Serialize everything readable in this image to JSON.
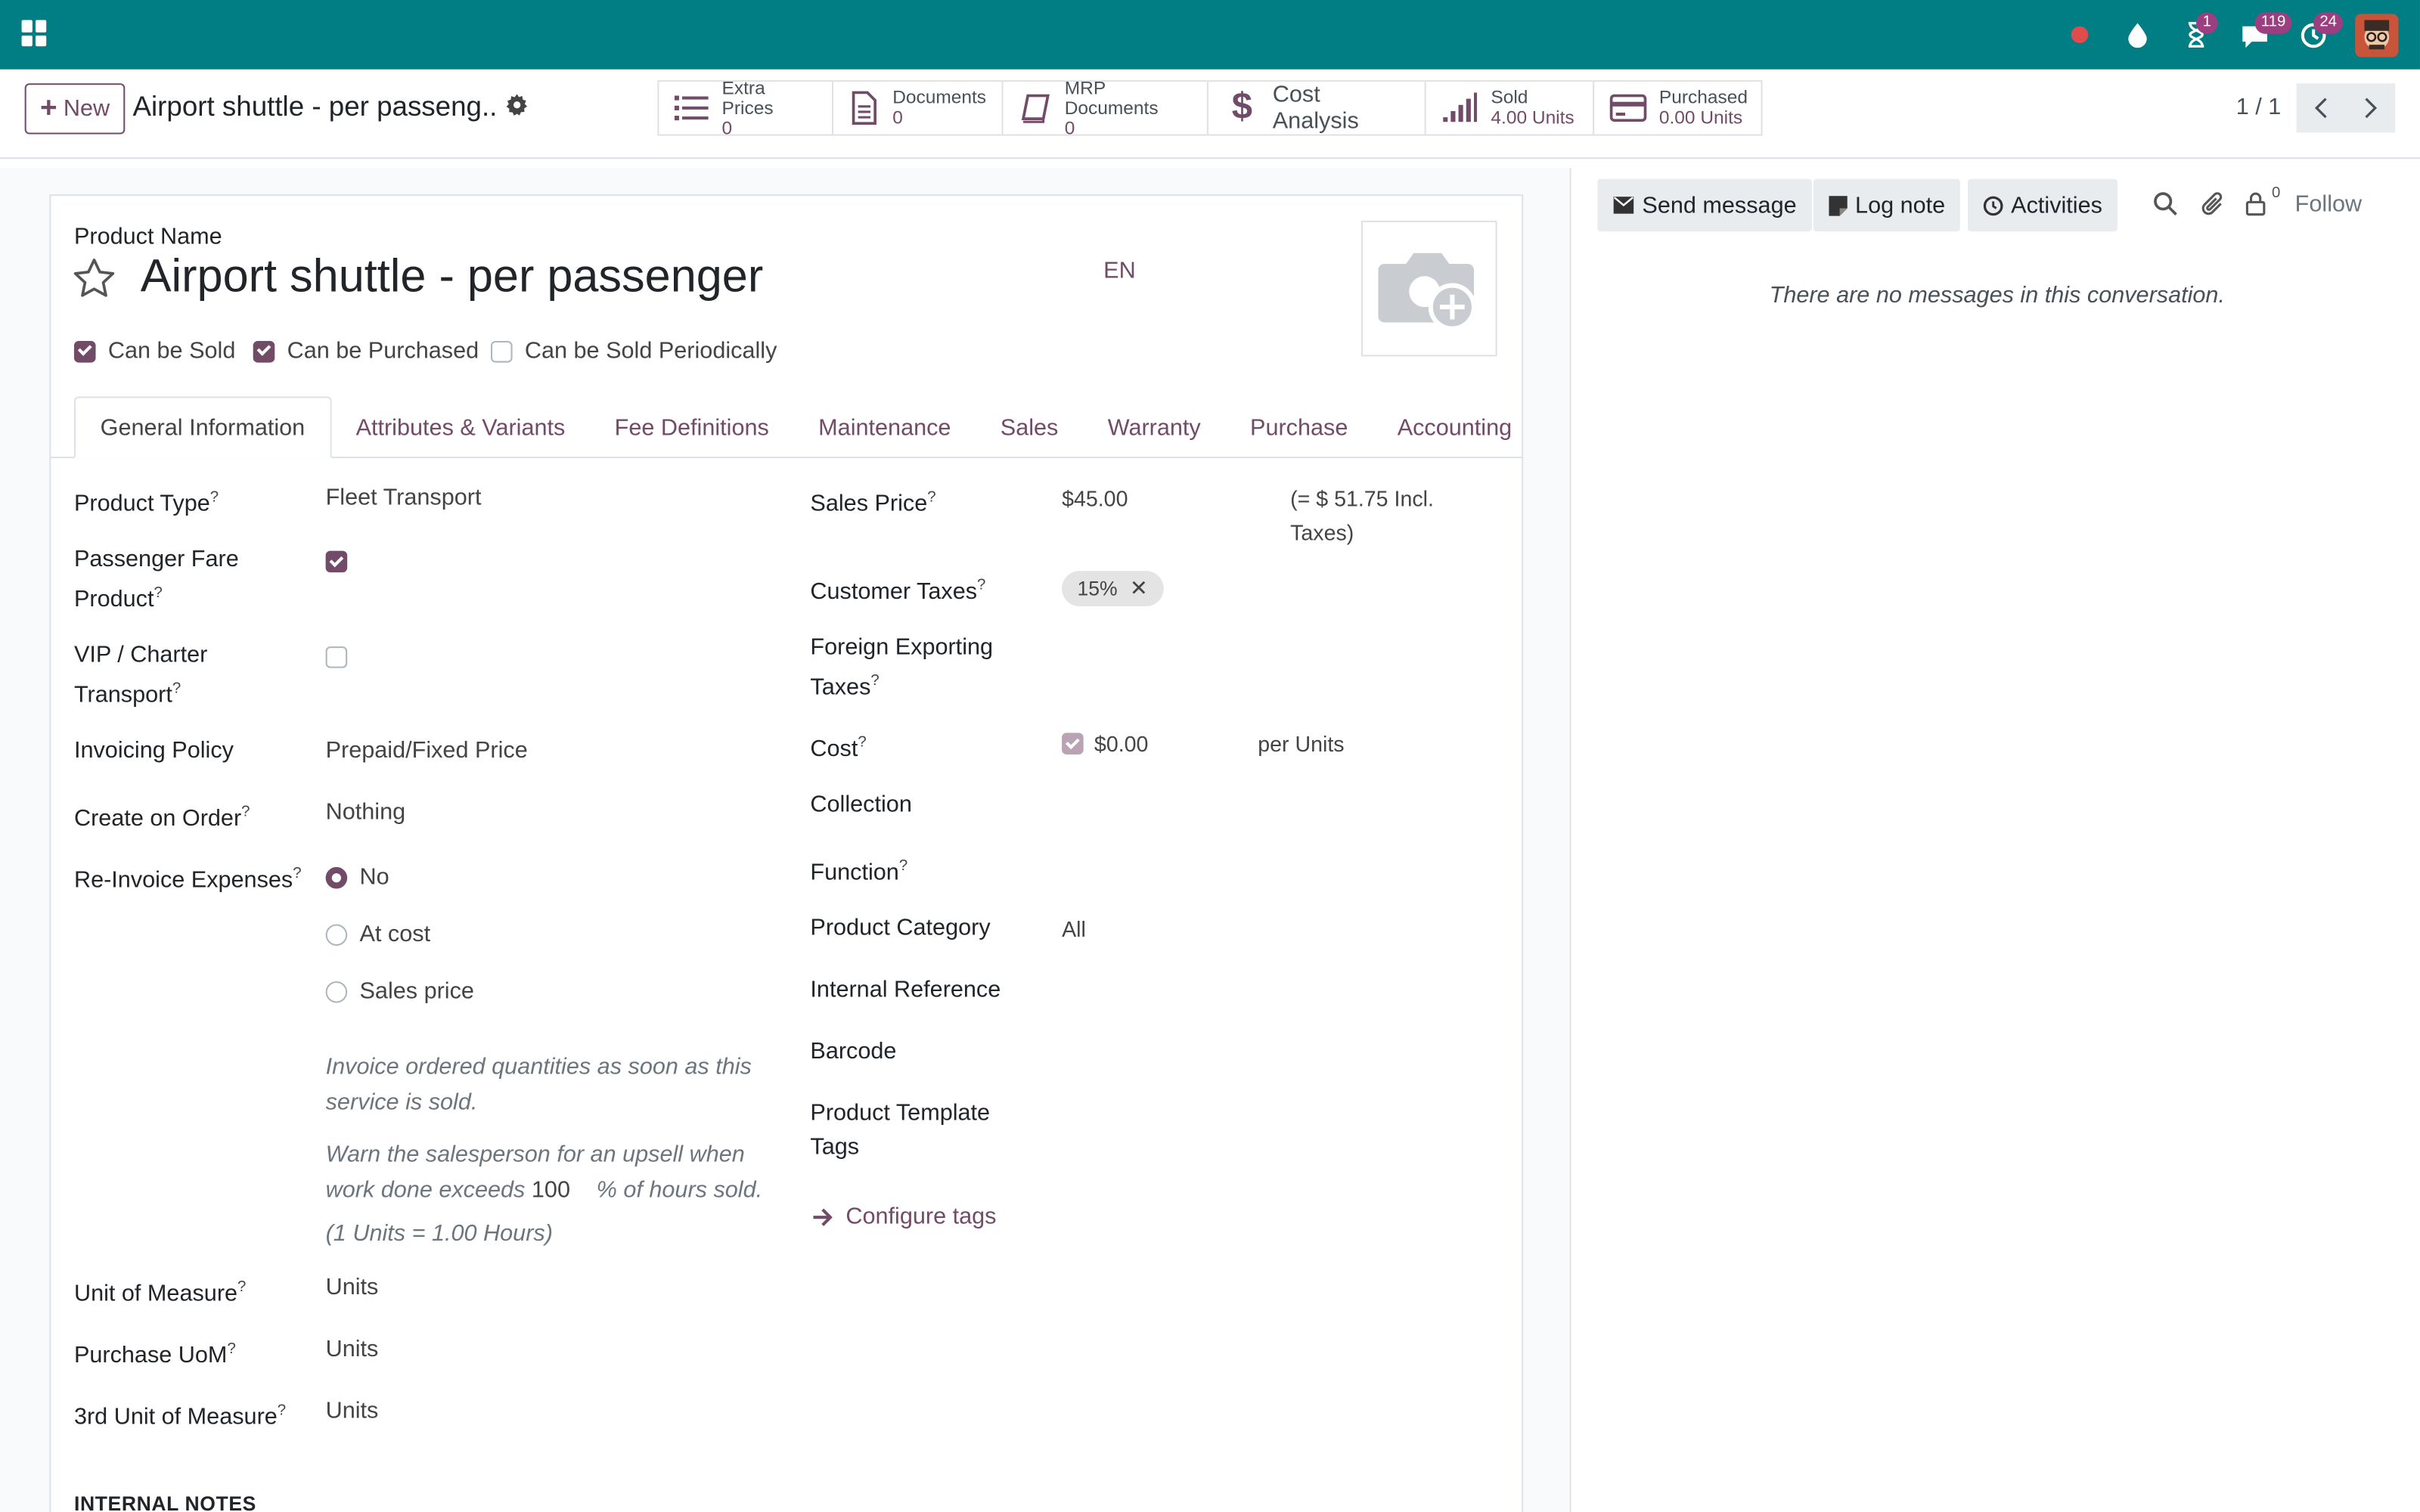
{
  "topbar": {
    "badges": {
      "activities": "1",
      "messages": "119",
      "clock": "24"
    },
    "colors": {
      "bar": "#017e84",
      "accent": "#714b67"
    }
  },
  "control_panel": {
    "new_label": "New",
    "record_title": "Airport shuttle - per passeng...",
    "pager": "1 / 1",
    "smart_buttons": [
      {
        "label": "Extra Prices",
        "value": "0",
        "icon": "list-icon"
      },
      {
        "label": "Documents",
        "value": "0",
        "icon": "document-icon"
      },
      {
        "label": "MRP Documents",
        "value": "0",
        "icon": "book-icon"
      },
      {
        "label": "Cost Analysis",
        "icon": "dollar-icon"
      },
      {
        "label": "Sold",
        "value": "4.00 Units",
        "icon": "signal-icon"
      },
      {
        "label": "Purchased",
        "value": "0.00 Units",
        "icon": "credit-card-icon"
      }
    ]
  },
  "form": {
    "product_name_label": "Product Name",
    "product_name": "Airport shuttle - per passenger",
    "lang": "EN",
    "checkboxes": {
      "can_be_sold": "Can be Sold",
      "can_be_purchased": "Can be Purchased",
      "can_be_sold_periodically": "Can be Sold Periodically"
    },
    "tabs": [
      "General Information",
      "Attributes & Variants",
      "Fee Definitions",
      "Maintenance",
      "Sales",
      "Warranty",
      "Purchase",
      "Accounting"
    ],
    "left": {
      "product_type_label": "Product Type",
      "product_type": "Fleet Transport",
      "passenger_fare_label_1": "Passenger Fare",
      "passenger_fare_label_2": "Product",
      "vip_label_1": "VIP / Charter",
      "vip_label_2": "Transport",
      "invoicing_policy_label": "Invoicing Policy",
      "invoicing_policy": "Prepaid/Fixed Price",
      "create_on_order_label": "Create on Order",
      "create_on_order": "Nothing",
      "reinvoice_label": "Re-Invoice Expenses",
      "reinvoice_options": [
        "No",
        "At cost",
        "Sales price"
      ],
      "note_1a": "Invoice ordered quantities as soon as this",
      "note_1b": "service is sold.",
      "note_2a": "Warn the salesperson for an upsell when",
      "note_2b_pre": "work done exceeds",
      "note_2b_value": "100",
      "note_2b_post": "% of hours sold.",
      "note_3": "(1 Units = 1.00 Hours)",
      "uom_label": "Unit of Measure",
      "uom": "Units",
      "purchase_uom_label": "Purchase UoM",
      "purchase_uom": "Units",
      "third_uom_label": "3rd Unit of Measure",
      "third_uom": "Units"
    },
    "right": {
      "sales_price_label": "Sales Price",
      "sales_price": "$45.00",
      "incl_taxes_1": "(= $ 51.75 Incl.",
      "incl_taxes_2": "Taxes)",
      "customer_taxes_label": "Customer Taxes",
      "customer_tax_tag": "15%",
      "foreign_taxes_label_1": "Foreign Exporting",
      "foreign_taxes_label_2": "Taxes",
      "cost_label": "Cost",
      "cost": "$0.00",
      "cost_unit": "per Units",
      "collection_label": "Collection",
      "function_label": "Function",
      "category_label": "Product Category",
      "category": "All",
      "internal_ref_label": "Internal Reference",
      "barcode_label": "Barcode",
      "template_tags_label_1": "Product Template",
      "template_tags_label_2": "Tags",
      "configure_tags": "Configure tags"
    },
    "internal_notes": "INTERNAL NOTES"
  },
  "chatter": {
    "send_message": "Send message",
    "log_note": "Log note",
    "activities": "Activities",
    "followers_count": "0",
    "follow": "Follow",
    "empty": "There are no messages in this conversation."
  }
}
